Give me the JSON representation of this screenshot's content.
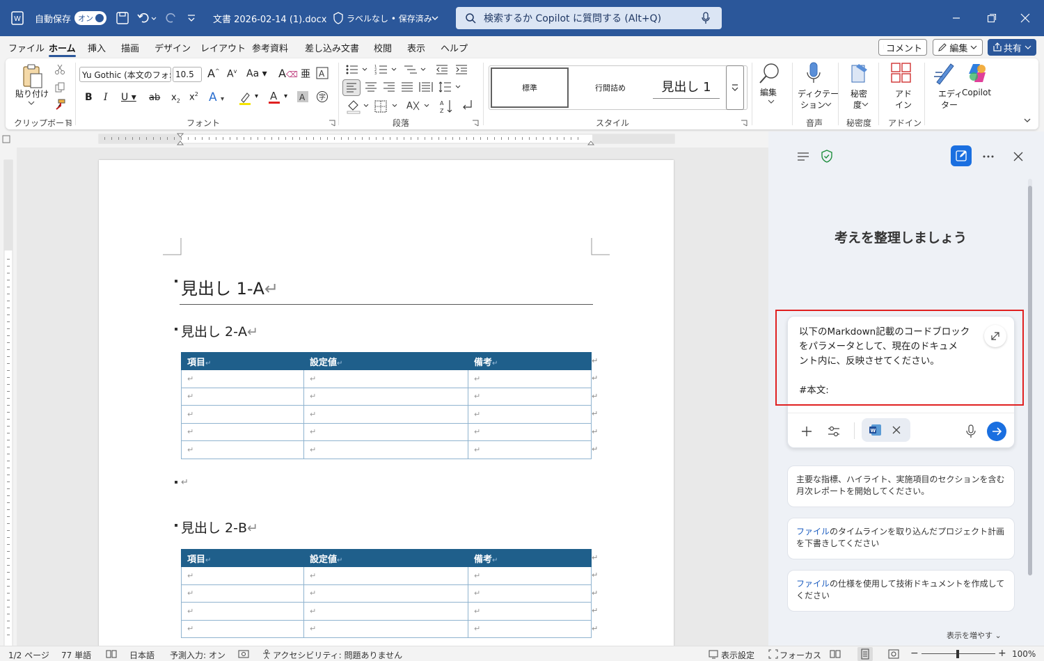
{
  "titlebar": {
    "autosave_label": "自動保存",
    "autosave_state": "オン",
    "document_title": "文書  2026-02-14 (1).docx",
    "sensitivity": "ラベルなし • 保存済み",
    "search_placeholder": "検索するか Copilot に質問する (Alt+Q)"
  },
  "menu": {
    "items": [
      "ファイル",
      "ホーム",
      "挿入",
      "描画",
      "デザイン",
      "レイアウト",
      "参考資料",
      "差し込み文書",
      "校閲",
      "表示",
      "ヘルプ"
    ],
    "comment_btn": "コメント",
    "edit_btn": "編集",
    "share_btn": "共有"
  },
  "ribbon": {
    "paste_label": "貼り付け",
    "clipboard_group": "クリップボード",
    "font_name": "Yu Gothic (本文のフォ:",
    "font_size": "10.5",
    "font_group": "フォント",
    "paragraph_group": "段落",
    "styles": [
      "標準",
      "行間詰め",
      "見出し 1"
    ],
    "styles_group": "スタイル",
    "edit_label": "編集",
    "dictate_label1": "ディクテー",
    "dictate_label2": "ション",
    "voice_group": "音声",
    "sensitivity_label1": "秘密",
    "sensitivity_label2": "度",
    "sensitivity_group": "秘密度",
    "addin_label1": "アド",
    "addin_label2": "イン",
    "addin_group": "アドイン",
    "editor_label1": "エディ",
    "editor_label2": "ター",
    "copilot_label": "Copilot"
  },
  "document": {
    "heading1": "見出し 1-A",
    "heading2a": "見出し 2-A",
    "heading2b": "見出し 2-B",
    "table_headers": [
      "項目",
      "設定値",
      "備考"
    ]
  },
  "copilot": {
    "heading": "考えを整理しましょう",
    "prompt_line1": "以下のMarkdown記載のコードブロック",
    "prompt_line2": "をパラメータとして、現在のドキュメ",
    "prompt_line3": "ント内に、反映させてください。",
    "prompt_line4": "#本文:",
    "suggestions": [
      {
        "prefix": "",
        "text": "主要な指標、ハイライト、実施項目のセクションを含む月次レポートを開始してください。"
      },
      {
        "prefix": "ファイル",
        "text": "のタイムラインを取り込んだプロジェクト計画を下書きしてください"
      },
      {
        "prefix": "ファイル",
        "text": "の仕様を使用して技術ドキュメントを作成してください"
      }
    ],
    "show_more": "表示を増やす"
  },
  "status": {
    "page": "1/2 ページ",
    "words": "77 単語",
    "language": "日本語",
    "predict": "予測入力: オン",
    "accessibility": "アクセシビリティ: 問題ありません",
    "display_settings": "表示設定",
    "focus": "フォーカス",
    "zoom": "100%"
  },
  "colors": {
    "titlebar": "#2b579a",
    "table_header": "#1f5f8b",
    "highlight_box": "#e02020",
    "copilot_accent": "#1a6fe0"
  }
}
